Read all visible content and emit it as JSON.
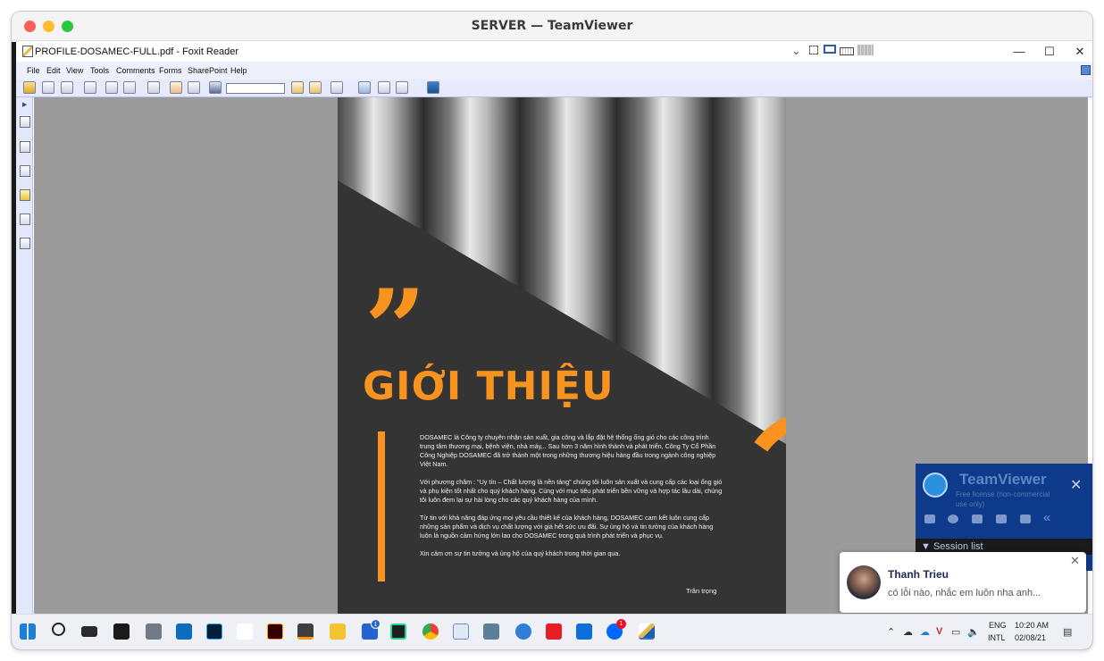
{
  "window": {
    "title": "SERVER — TeamViewer"
  },
  "foxit": {
    "document_title": "PROFILE-DOSAMEC-FULL.pdf - Foxit Reader",
    "menu": [
      "File",
      "Edit",
      "View",
      "Tools",
      "Comments",
      "Forms",
      "SharePoint",
      "Help"
    ],
    "window_controls": {
      "minimize": "—",
      "maximize": "☐",
      "close": "✕"
    },
    "search_value": ""
  },
  "pdf_page": {
    "quote_mark": "”",
    "heading": "GIỚI THIỆU",
    "paragraphs": [
      "DOSAMEC là Công ty chuyên nhận sản xuất, gia công và lắp đặt hệ thống ống gió cho các công trình trung tâm thương mại, bệnh viện, nhà máy,.. Sau hơn 3 năm hình thành và phát triển, Công Ty Cổ Phần Công Nghiệp DOSAMEC đã trở thành một trong những thương hiệu hàng đầu trong ngành công nghiệp Việt Nam.",
      "Với phương châm : “Uy tín – Chất lượng là nền tảng” chúng tôi luôn sản xuất và cung cấp các loại ống gió và phụ kiện tốt nhất cho quý khách hàng. Cùng với mục tiêu phát triển bền vững và hợp tác lâu dài, chúng tôi luôn đem lại sự hài lòng cho các quý khách hàng của mình.",
      "Từ tin với khả năng đáp ứng mọi yêu cầu thiết kế của khách hàng, DOSAMEC cam kết luôn cung cấp những sản phẩm và dịch vụ chất lượng với giá hết sức ưu đãi. Sự ủng hộ và tin tưởng của khách hàng luôn là nguồn cảm hứng lớn lao cho DOSAMEC trong quá trình phát triển và phục vụ.",
      "Xin cảm ơn sự tin tưởng và ủng hộ của quý khách trong thời gian qua."
    ],
    "signoff": "Trân trọng"
  },
  "teamviewer_panel": {
    "name": "TeamViewer",
    "license": "Free license (non-commercial use only)",
    "close": "✕",
    "session_list": "Session list"
  },
  "chat": {
    "sender": "Thanh Trieu",
    "message": "có lỗi nào, nhắc em luôn nha anh...",
    "close": "✕"
  },
  "taskbar": {
    "language_line1": "ENG",
    "language_line2": "INTL",
    "time": "10:20 AM",
    "date": "02/08/21",
    "badge_todo": "1",
    "badge_zalo": "1"
  },
  "colors": {
    "accent_orange": "#f7931e",
    "page_dark": "#333333",
    "teamviewer_blue": "#0e3a8c"
  }
}
